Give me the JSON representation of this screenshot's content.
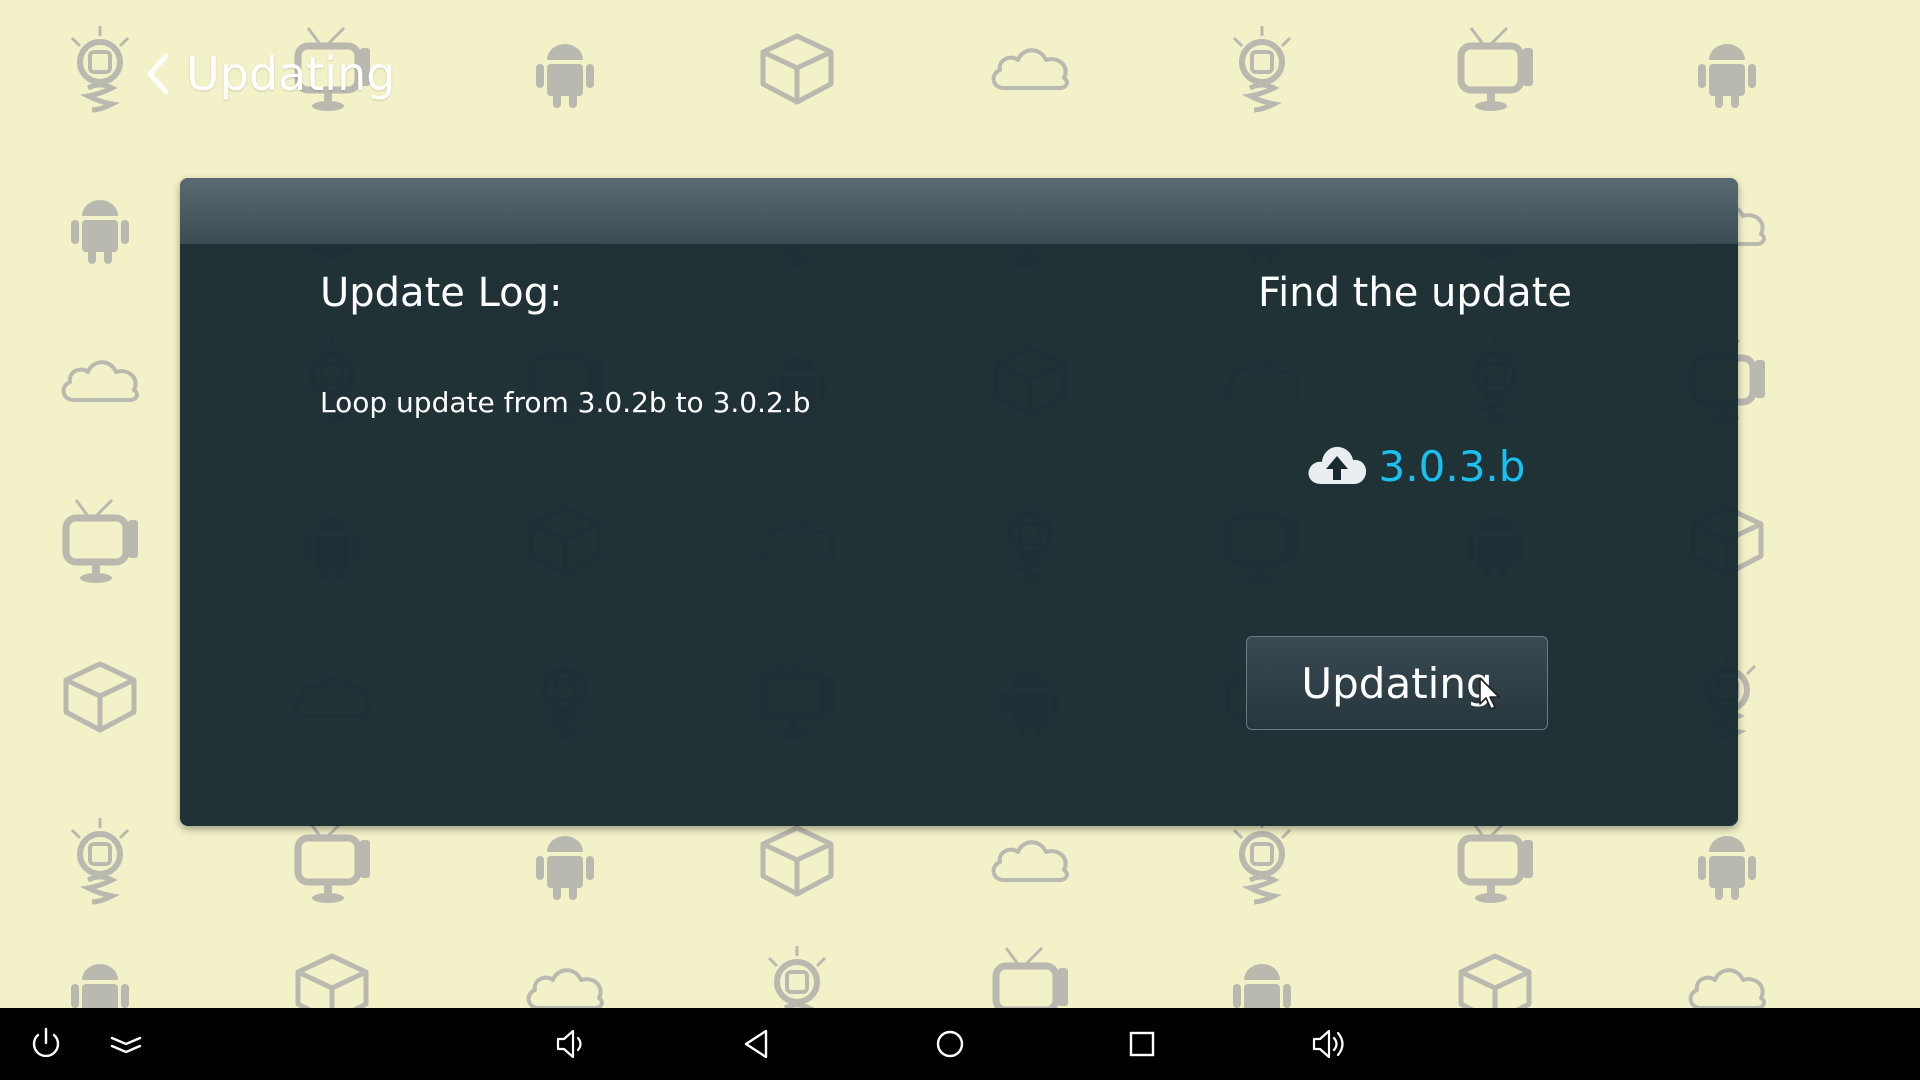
{
  "header": {
    "title": "Updating",
    "back_icon": "chevron-left-icon"
  },
  "dialog": {
    "log_title": "Update Log:",
    "log_text": "Loop update from 3.0.2b to 3.0.2.b",
    "find_title": "Find the update",
    "version": "3.0.3.b",
    "version_icon": "cloud-upload-icon",
    "button_label": "Updating"
  },
  "colors": {
    "background": "#f3f1c8",
    "pattern_icon": "#b9b9b0",
    "panel": "#182a30",
    "accent": "#17c1f2",
    "navbar": "#000000"
  },
  "navbar": {
    "buttons": [
      "power-icon",
      "collapse-icon",
      "volume-down-icon",
      "back-triangle-icon",
      "home-circle-icon",
      "recents-square-icon",
      "volume-up-icon"
    ]
  },
  "background_pattern": [
    "lightbulb-icon",
    "tv-icon",
    "android-icon",
    "box-icon",
    "cloud-icon"
  ]
}
